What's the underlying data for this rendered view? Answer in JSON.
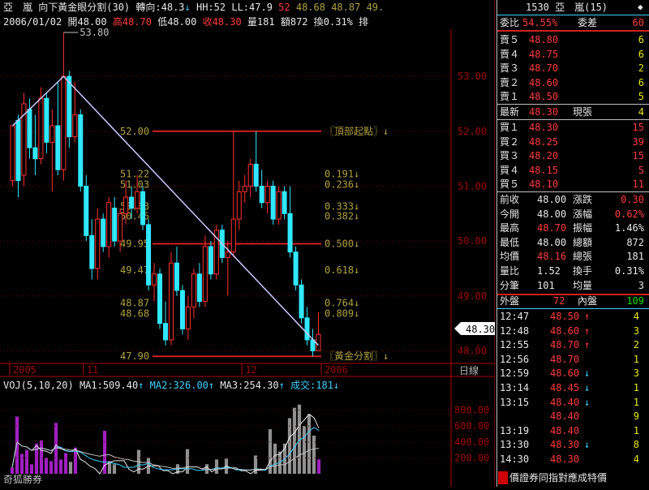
{
  "header": {
    "stock_name": "亞　嵐",
    "indicator": "向下黃金眼分割(30)",
    "turn_label": "轉向:48.3",
    "turn_arrow": "↓",
    "hh": "HH:52",
    "ll": "LL:47.9",
    "vals": [
      "52",
      "48.68",
      "48.87",
      "49."
    ],
    "date": "2006/01/02",
    "open": "開48.00",
    "high": "高48.70",
    "low": "低48.00",
    "close": "收48.30",
    "vol": "量181",
    "amount": "額872",
    "turnover": "換0.31%",
    "extra": "排"
  },
  "chart_data": [
    {
      "type": "candlestick",
      "title": "向下黃金眼分割(30)",
      "ylim": [
        47.8,
        53.8
      ],
      "y_ticks": [
        "53.00",
        "52.00",
        "51.00",
        "50.00",
        "49.00",
        "48.00"
      ],
      "x_labels": [
        "2005",
        "11",
        "12",
        "2006"
      ],
      "x_label_index": [
        0,
        13,
        41,
        62
      ],
      "colors": {
        "up": "#ff3030",
        "down": "#30e8ff",
        "line": "#c8c8ff",
        "level": "#d02020",
        "label": "#b0a040"
      },
      "candles": [
        {
          "o": 51.1,
          "h": 51.3,
          "l": 51.0,
          "c": 52.1
        },
        {
          "o": 52.2,
          "h": 52.3,
          "l": 50.8,
          "c": 51.1
        },
        {
          "o": 51.2,
          "h": 52.7,
          "l": 51.0,
          "c": 52.5
        },
        {
          "o": 52.4,
          "h": 52.6,
          "l": 51.5,
          "c": 51.7
        },
        {
          "o": 51.7,
          "h": 52.3,
          "l": 51.2,
          "c": 51.5
        },
        {
          "o": 51.5,
          "h": 52.8,
          "l": 51.4,
          "c": 52.6
        },
        {
          "o": 52.6,
          "h": 52.7,
          "l": 51.6,
          "c": 51.8
        },
        {
          "o": 51.8,
          "h": 52.4,
          "l": 50.9,
          "c": 52.1
        },
        {
          "o": 52.1,
          "h": 52.9,
          "l": 51.2,
          "c": 51.3
        },
        {
          "o": 51.3,
          "h": 53.8,
          "l": 51.1,
          "c": 53.0
        },
        {
          "o": 53.0,
          "h": 53.1,
          "l": 51.7,
          "c": 51.9
        },
        {
          "o": 51.9,
          "h": 52.9,
          "l": 51.8,
          "c": 52.3
        },
        {
          "o": 52.3,
          "h": 52.4,
          "l": 50.9,
          "c": 51.0
        },
        {
          "o": 51.0,
          "h": 51.2,
          "l": 50.0,
          "c": 50.1
        },
        {
          "o": 50.1,
          "h": 50.4,
          "l": 49.3,
          "c": 49.5
        },
        {
          "o": 49.5,
          "h": 50.6,
          "l": 49.3,
          "c": 50.4
        },
        {
          "o": 50.4,
          "h": 50.5,
          "l": 49.8,
          "c": 49.9
        },
        {
          "o": 49.9,
          "h": 50.8,
          "l": 49.7,
          "c": 50.7
        },
        {
          "o": 50.6,
          "h": 50.8,
          "l": 49.9,
          "c": 50.0
        },
        {
          "o": 50.0,
          "h": 50.6,
          "l": 49.8,
          "c": 50.5
        },
        {
          "o": 50.5,
          "h": 51.1,
          "l": 50.3,
          "c": 50.8
        },
        {
          "o": 50.8,
          "h": 51.0,
          "l": 50.4,
          "c": 50.6
        },
        {
          "o": 50.6,
          "h": 51.2,
          "l": 50.5,
          "c": 50.9
        },
        {
          "o": 50.9,
          "h": 51.0,
          "l": 50.2,
          "c": 50.3
        },
        {
          "o": 50.3,
          "h": 50.4,
          "l": 49.1,
          "c": 49.2
        },
        {
          "o": 49.2,
          "h": 49.6,
          "l": 48.9,
          "c": 49.4
        },
        {
          "o": 49.4,
          "h": 49.5,
          "l": 48.4,
          "c": 48.5
        },
        {
          "o": 48.5,
          "h": 48.9,
          "l": 48.1,
          "c": 48.2
        },
        {
          "o": 48.2,
          "h": 49.8,
          "l": 48.1,
          "c": 49.6
        },
        {
          "o": 49.6,
          "h": 49.9,
          "l": 49.0,
          "c": 49.1
        },
        {
          "o": 49.1,
          "h": 49.2,
          "l": 48.3,
          "c": 48.4
        },
        {
          "o": 48.4,
          "h": 49.0,
          "l": 48.2,
          "c": 48.8
        },
        {
          "o": 48.8,
          "h": 49.5,
          "l": 48.6,
          "c": 49.4
        },
        {
          "o": 49.4,
          "h": 49.6,
          "l": 48.8,
          "c": 48.9
        },
        {
          "o": 48.9,
          "h": 50.1,
          "l": 48.8,
          "c": 49.9
        },
        {
          "o": 49.9,
          "h": 50.0,
          "l": 49.3,
          "c": 49.4
        },
        {
          "o": 49.4,
          "h": 50.3,
          "l": 49.3,
          "c": 50.2
        },
        {
          "o": 50.2,
          "h": 50.3,
          "l": 49.6,
          "c": 49.7
        },
        {
          "o": 49.7,
          "h": 50.0,
          "l": 49.0,
          "c": 49.8
        },
        {
          "o": 49.8,
          "h": 52.0,
          "l": 49.7,
          "c": 50.4
        },
        {
          "o": 50.4,
          "h": 51.1,
          "l": 50.2,
          "c": 50.9
        },
        {
          "o": 50.9,
          "h": 51.2,
          "l": 50.7,
          "c": 51.0
        },
        {
          "o": 51.0,
          "h": 51.5,
          "l": 50.8,
          "c": 51.4
        },
        {
          "o": 51.4,
          "h": 52.0,
          "l": 50.9,
          "c": 51.0
        },
        {
          "o": 51.0,
          "h": 51.3,
          "l": 50.6,
          "c": 50.7
        },
        {
          "o": 50.7,
          "h": 51.1,
          "l": 50.5,
          "c": 51.0
        },
        {
          "o": 51.0,
          "h": 51.1,
          "l": 50.3,
          "c": 50.4
        },
        {
          "o": 50.4,
          "h": 51.0,
          "l": 50.3,
          "c": 50.9
        },
        {
          "o": 50.9,
          "h": 51.0,
          "l": 50.4,
          "c": 50.5
        },
        {
          "o": 50.5,
          "h": 51.0,
          "l": 49.7,
          "c": 49.8
        },
        {
          "o": 49.8,
          "h": 49.9,
          "l": 49.1,
          "c": 49.2
        },
        {
          "o": 49.2,
          "h": 49.3,
          "l": 48.5,
          "c": 48.6
        },
        {
          "o": 48.6,
          "h": 48.8,
          "l": 48.1,
          "c": 48.2
        },
        {
          "o": 48.2,
          "h": 48.4,
          "l": 47.9,
          "c": 48.0
        },
        {
          "o": 48.0,
          "h": 48.7,
          "l": 48.0,
          "c": 48.3
        }
      ],
      "trendline": {
        "from_index": 9,
        "from_price": 53.0,
        "to_index": 54,
        "to_price": 48.1,
        "start_index": 0,
        "start_price": 52.1
      },
      "annotation_high": "53.80",
      "levels": [
        {
          "price": 52.0,
          "left": "52.00",
          "right": "〖頂部起點〗↓",
          "line": true
        },
        {
          "price": 51.22,
          "left": "51.22",
          "right": "0.191↓",
          "line": false
        },
        {
          "price": 51.03,
          "left": "51.03",
          "right": "0.236↓",
          "line": false
        },
        {
          "price": 50.63,
          "left": "50.63",
          "right": "0.333↓",
          "line": false
        },
        {
          "price": 50.45,
          "left": "50.45",
          "right": "0.382↓",
          "line": false
        },
        {
          "price": 49.95,
          "left": "49.95",
          "right": "0.500↓",
          "line": true
        },
        {
          "price": 49.47,
          "left": "49.47",
          "right": "0.618↓",
          "line": false
        },
        {
          "price": 48.87,
          "left": "48.87",
          "right": "0.764↓",
          "line": false
        },
        {
          "price": 48.68,
          "left": "48.68",
          "right": "0.809↓",
          "line": false
        },
        {
          "price": 47.9,
          "left": "47.90",
          "right": "〖黃金分割〗↓",
          "line": true
        }
      ],
      "current_price_tag": "48.30",
      "period_label": "日線"
    },
    {
      "type": "bar",
      "title": "VOJ(5,10,20)",
      "ylim": [
        0,
        1000
      ],
      "y_ticks": [
        "800.00",
        "600.00",
        "400.00",
        "200.00"
      ],
      "legend": [
        {
          "label": "MA1:509.40",
          "arrow": "↑",
          "color": "#e8e8e8"
        },
        {
          "label": "MA2:326.00",
          "arrow": "↑",
          "color": "#40d0ff"
        },
        {
          "label": "MA3:254.30",
          "arrow": "↑",
          "color": "#e8e8e8"
        },
        {
          "label": "成交:181",
          "arrow": "↓",
          "color": "#40d0ff"
        }
      ],
      "values": [
        80,
        720,
        250,
        300,
        120,
        380,
        420,
        200,
        160,
        640,
        180,
        260,
        150,
        330,
        0,
        0,
        0,
        0,
        0,
        540,
        160,
        120,
        0,
        0,
        0,
        0,
        300,
        0,
        200,
        0,
        0,
        0,
        0,
        0,
        120,
        0,
        310,
        0,
        0,
        0,
        120,
        0,
        180,
        0,
        190,
        0,
        0,
        0,
        0,
        0,
        230,
        0,
        0,
        560,
        380,
        280,
        380,
        700,
        830,
        870,
        600,
        750,
        480,
        181
      ],
      "colors_seq": [
        "p",
        "p",
        "p",
        "p",
        "p",
        "p",
        "p",
        "p",
        "p",
        "p",
        "p",
        "p",
        "g",
        "p",
        "g",
        "g",
        "g",
        "g",
        "g",
        "p",
        "g",
        "g",
        "g",
        "g",
        "g",
        "g",
        "g",
        "g",
        "g",
        "g",
        "g",
        "g",
        "g",
        "g",
        "g",
        "g",
        "g",
        "g",
        "g",
        "g",
        "g",
        "g",
        "g",
        "g",
        "g",
        "g",
        "g",
        "g",
        "g",
        "g",
        "g",
        "g",
        "g",
        "g",
        "g",
        "g",
        "g",
        "g",
        "g",
        "g",
        "g",
        "g",
        "g",
        "p"
      ],
      "watermark": "奇狐勝券"
    }
  ],
  "quote": {
    "code_name": "1530 亞　嵐(15)",
    "wei_bi_label": "委比",
    "wei_bi_value": "54.55%",
    "wei_cha_label": "委差",
    "wei_cha_value": "60",
    "asks": [
      {
        "label": "賣５",
        "price": "48.80",
        "qty": "6"
      },
      {
        "label": "賣４",
        "price": "48.75",
        "qty": "6"
      },
      {
        "label": "賣３",
        "price": "48.70",
        "qty": "2"
      },
      {
        "label": "賣２",
        "price": "48.60",
        "qty": "6"
      },
      {
        "label": "賣１",
        "price": "48.50",
        "qty": "5"
      }
    ],
    "last_label": "最新",
    "last_price": "48.30",
    "xianzhang_label": "現張",
    "xianzhang_value": "4",
    "bids": [
      {
        "label": "買１",
        "price": "48.30",
        "qty": "15"
      },
      {
        "label": "買２",
        "price": "48.25",
        "qty": "39"
      },
      {
        "label": "買３",
        "price": "48.20",
        "qty": "15"
      },
      {
        "label": "買４",
        "price": "48.15",
        "qty": "5"
      },
      {
        "label": "買５",
        "price": "48.10",
        "qty": "11"
      }
    ],
    "stats": [
      {
        "l1": "前收",
        "v1": "48.00",
        "c1": "wht",
        "l2": "漲跌",
        "v2": "0.30",
        "c2": "red"
      },
      {
        "l1": "今開",
        "v1": "48.00",
        "c1": "wht",
        "l2": "漲幅",
        "v2": "0.62%",
        "c2": "red"
      },
      {
        "l1": "最高",
        "v1": "48.70",
        "c1": "red",
        "l2": "振幅",
        "v2": "1.46%",
        "c2": "wht"
      },
      {
        "l1": "最低",
        "v1": "48.00",
        "c1": "wht",
        "l2": "總額",
        "v2": "872",
        "c2": "wht"
      },
      {
        "l1": "均價",
        "v1": "48.16",
        "c1": "red",
        "l2": "總張",
        "v2": "181",
        "c2": "wht"
      },
      {
        "l1": "量比",
        "v1": "1.52",
        "c1": "wht",
        "l2": "換手",
        "v2": "0.31%",
        "c2": "wht"
      },
      {
        "l1": "分筆",
        "v1": "101",
        "c1": "wht",
        "l2": "均量",
        "v2": "3",
        "c2": "wht"
      }
    ],
    "outer_label": "外盤",
    "outer_value": "72",
    "inner_label": "內盤",
    "inner_value": "109",
    "ticks": [
      {
        "time": "12:47",
        "price": "48.50",
        "dir": "↑",
        "qty": "4"
      },
      {
        "time": "12:48",
        "price": "48.60",
        "dir": "↑",
        "qty": "3"
      },
      {
        "time": "12:55",
        "price": "48.70",
        "dir": "↑",
        "qty": "2"
      },
      {
        "time": "12:56",
        "price": "48.70",
        "dir": "",
        "qty": "1"
      },
      {
        "time": "12:59",
        "price": "48.60",
        "dir": "↓",
        "qty": "3"
      },
      {
        "time": "13:14",
        "price": "48.45",
        "dir": "↓",
        "qty": "1"
      },
      {
        "time": "13:15",
        "price": "48.40",
        "dir": "↓",
        "qty": "1"
      },
      {
        "time": "",
        "price": "48.40",
        "dir": "",
        "qty": "9"
      },
      {
        "time": "13:19",
        "price": "48.40",
        "dir": "",
        "qty": "1"
      },
      {
        "time": "13:30",
        "price": "48.30",
        "dir": "↓",
        "qty": "8"
      },
      {
        "time": "14:30",
        "price": "48.30",
        "dir": "",
        "qty": "4"
      }
    ],
    "footer_text": "價證券同指對應成特價"
  }
}
